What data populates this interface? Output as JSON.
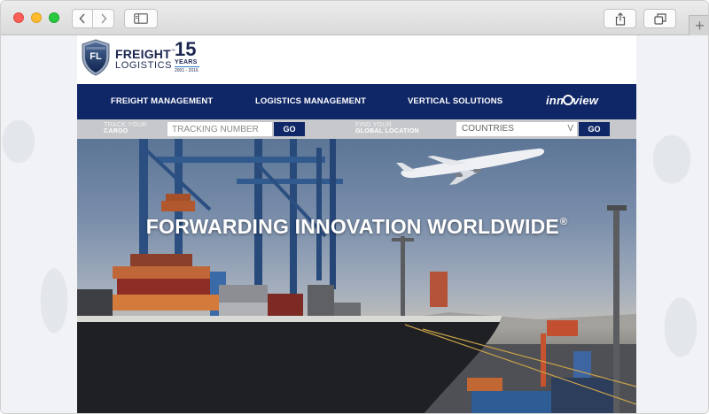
{
  "browser": {
    "new_tab": "+"
  },
  "brand": {
    "logo_initials": "FL",
    "name_line1": "FREIGHT",
    "name_line2": "LOGISTICS",
    "tm": "™",
    "anniversary_number": "15",
    "anniversary_label": "YEARS",
    "anniversary_range": "2001 - 2016"
  },
  "nav": {
    "items": [
      {
        "label": "FREIGHT MANAGEMENT"
      },
      {
        "label": "LOGISTICS MANAGEMENT"
      },
      {
        "label": "VERTICAL SOLUTIONS"
      }
    ],
    "partner_logo_prefix": "inn",
    "partner_logo_suffix": "view"
  },
  "search": {
    "track_label_line1": "TRACK YOUR",
    "track_label_line2": "CARGO",
    "tracking_placeholder": "TRACKING NUMBER",
    "go_label": "GO",
    "find_label_line1": "FIND YOUR",
    "find_label_line2": "GLOBAL LOCATION",
    "countries_value": "COUNTRIES",
    "countries_chevron": "V"
  },
  "hero": {
    "headline": "FORWARDING INNOVATION WORLDWIDE",
    "registered": "®"
  },
  "colors": {
    "navy": "#0f2667",
    "search_bar": "#c6c8cc"
  }
}
